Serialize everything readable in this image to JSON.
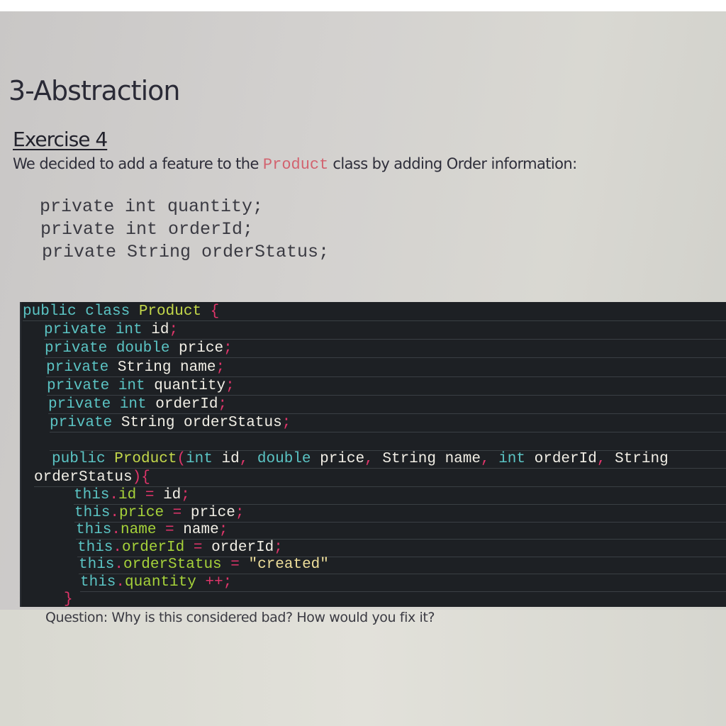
{
  "section_title": "3-Abstraction",
  "exercise_title": "Exercise 4",
  "intro": {
    "before": "We decided to add a feature to the ",
    "code_ref": "Product",
    "after": " class by adding Order information:"
  },
  "new_fields": [
    "private int quantity;",
    "private int orderId;",
    "private String orderStatus;"
  ],
  "code": {
    "class_line": {
      "kw": "public class ",
      "name": "Product",
      "brace": " {"
    },
    "fields": [
      {
        "mod": "private ",
        "type": "int ",
        "name": "id",
        "end": ";"
      },
      {
        "mod": "private ",
        "type": "double ",
        "name": "price",
        "end": ";"
      },
      {
        "mod": "private ",
        "type": "String ",
        "name": "name",
        "end": ";"
      },
      {
        "mod": "private ",
        "type": "int ",
        "name": "quantity",
        "end": ";"
      },
      {
        "mod": "private ",
        "type": "int ",
        "name": "orderId",
        "end": ";"
      },
      {
        "mod": "private ",
        "type": "String ",
        "name": "orderStatus",
        "end": ";"
      }
    ],
    "ctor": {
      "kw": "public ",
      "name": "Product",
      "open": "(",
      "p1_type": "int ",
      "p1_name": "id",
      "comma1": ", ",
      "p2_type": "double ",
      "p2_name": "price",
      "comma2": ", ",
      "p3": "String name",
      "comma3": ", ",
      "p4_type": "int ",
      "p4_name": "orderId",
      "comma4": ", ",
      "p5_type": "String",
      "p5_name": "orderStatus",
      "close": ")",
      "brace": "{"
    },
    "body": [
      {
        "this": "this",
        "dot": ".",
        "field": "id",
        "op": " = ",
        "value": "id",
        "value_kind": "id",
        "end": ";"
      },
      {
        "this": "this",
        "dot": ".",
        "field": "price",
        "op": " = ",
        "value": "price",
        "value_kind": "id",
        "end": ";"
      },
      {
        "this": "this",
        "dot": ".",
        "field": "name",
        "op": " = ",
        "value": "name",
        "value_kind": "id",
        "end": ";"
      },
      {
        "this": "this",
        "dot": ".",
        "field": "orderId",
        "op": " = ",
        "value": "orderId",
        "value_kind": "id",
        "end": ";"
      },
      {
        "this": "this",
        "dot": ".",
        "field": "orderStatus",
        "op": " = ",
        "value": "\"created\"",
        "value_kind": "str",
        "end": ""
      },
      {
        "this": "this",
        "dot": ".",
        "field": "quantity",
        "op": " ++;",
        "value": "",
        "value_kind": "id",
        "end": ""
      }
    ],
    "closing_brace": "}"
  },
  "question": "Question: Why is this considered bad? How would you fix it?",
  "colors": {
    "keyword": "#5bc4c4",
    "class_name": "#c4d84a",
    "punctuation": "#e0356a",
    "identifier": "#f2efe6",
    "field": "#a6d23a",
    "string": "#eede9a",
    "code_background": "#1d2024",
    "inline_code": "#d2636f"
  }
}
